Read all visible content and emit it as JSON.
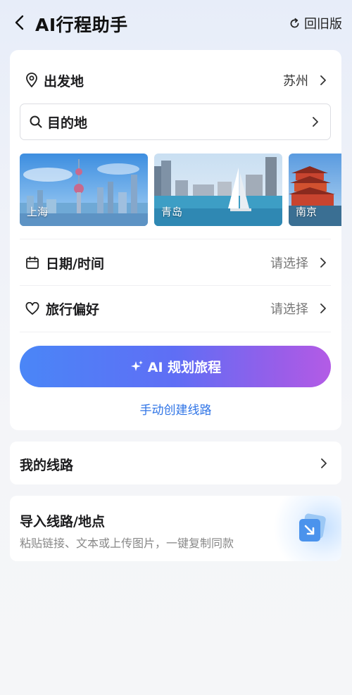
{
  "header": {
    "title": "AI行程助手",
    "old_version_label": "回旧版"
  },
  "trip": {
    "departure_label": "出发地",
    "departure_value": "苏州",
    "destination_label": "目的地",
    "cities": [
      {
        "name": "上海"
      },
      {
        "name": "青岛"
      },
      {
        "name": "南京"
      }
    ],
    "date_label": "日期/时间",
    "date_value": "请选择",
    "pref_label": "旅行偏好",
    "pref_value": "请选择",
    "ai_button_label": "AI 规划旅程",
    "manual_link": "手动创建线路"
  },
  "my_routes": {
    "label": "我的线路"
  },
  "import": {
    "title": "导入线路/地点",
    "subtitle": "粘贴链接、文本或上传图片，一键复制同款"
  },
  "colors": {
    "accent_blue": "#2f74e6",
    "gradient_start": "#4a86f7",
    "gradient_end": "#b35ce6"
  }
}
